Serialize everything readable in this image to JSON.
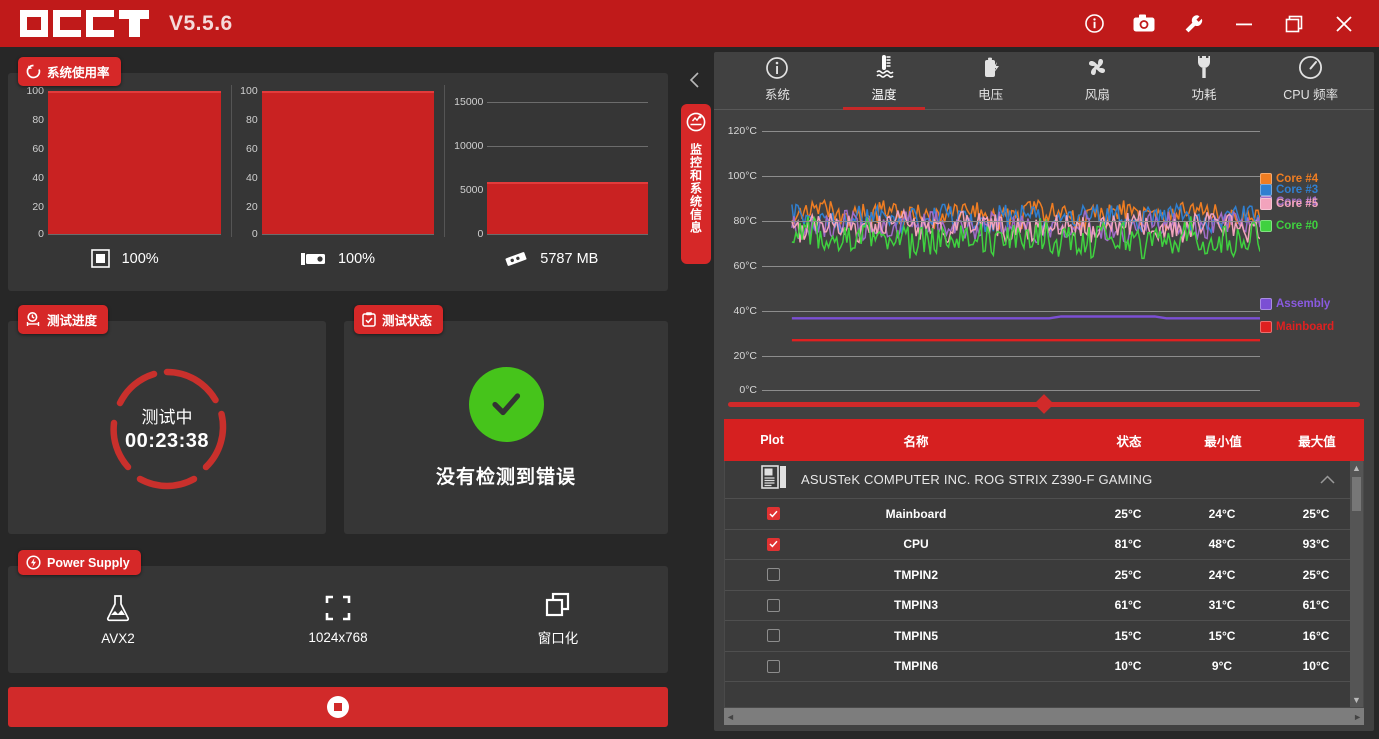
{
  "titlebar": {
    "app_name": "OCCT",
    "version": "V5.5.6",
    "brand_color": "#c01a1a",
    "actions": [
      {
        "name": "info-icon",
        "label": "Info"
      },
      {
        "name": "camera-icon",
        "label": "Screenshot"
      },
      {
        "name": "wrench-icon",
        "label": "Settings"
      },
      {
        "name": "minimize-icon",
        "label": "Minimize"
      },
      {
        "name": "restore-icon",
        "label": "Restore"
      },
      {
        "name": "close-icon",
        "label": "Close"
      }
    ]
  },
  "left": {
    "usage": {
      "badge": "系统使用率",
      "gauges": [
        {
          "label": "100%",
          "icon": "cpu-icon",
          "ticks": [
            "100",
            "80",
            "60",
            "40",
            "20",
            "0"
          ],
          "max": 100,
          "value": 100
        },
        {
          "label": "100%",
          "icon": "gpu-icon",
          "ticks": [
            "100",
            "80",
            "60",
            "40",
            "20",
            "0"
          ],
          "max": 100,
          "value": 100
        },
        {
          "label": "5787 MB",
          "icon": "ram-icon",
          "ticks": [
            "15000",
            "10000",
            "5000",
            "0"
          ],
          "max": 16384,
          "value": 5787
        }
      ]
    },
    "progress": {
      "badge": "测试进度",
      "state_label": "测试中",
      "elapsed": "00:23:38"
    },
    "status": {
      "badge": "测试状态",
      "message": "没有检测到错误",
      "ok_color": "#46c41b"
    },
    "power_supply": {
      "badge": "Power Supply",
      "items": [
        {
          "icon": "flask-icon",
          "label": "AVX2"
        },
        {
          "icon": "resolution-icon",
          "label": "1024x768"
        },
        {
          "icon": "window-icon",
          "label": "窗口化"
        }
      ]
    },
    "stop_button": {
      "label": "",
      "icon": "stop-icon"
    }
  },
  "sidebar": {
    "collapse_icon": "chevron-left-icon",
    "vertical_tab": {
      "label": "监控和系统信息",
      "icon": "monitor-icon"
    }
  },
  "right": {
    "tabs": [
      {
        "label": "系统",
        "icon": "info-circle-icon",
        "active": false
      },
      {
        "label": "温度",
        "icon": "thermometer-icon",
        "active": true
      },
      {
        "label": "电压",
        "icon": "battery-bolt-icon",
        "active": false
      },
      {
        "label": "风扇",
        "icon": "fan-icon",
        "active": false
      },
      {
        "label": "功耗",
        "icon": "plug-icon",
        "active": false
      },
      {
        "label": "CPU 频率",
        "icon": "speedometer-icon",
        "active": false
      }
    ],
    "table": {
      "columns": [
        "Plot",
        "名称",
        "状态",
        "最小值",
        "最大值"
      ],
      "group": {
        "icon": "motherboard-icon",
        "name": "ASUSTeK COMPUTER INC. ROG STRIX Z390-F GAMING",
        "collapse_icon": "chevron-up-icon"
      },
      "rows": [
        {
          "checked": true,
          "name": "Mainboard",
          "current": "25°C",
          "min": "24°C",
          "max": "25°C"
        },
        {
          "checked": true,
          "name": "CPU",
          "current": "81°C",
          "min": "48°C",
          "max": "93°C"
        },
        {
          "checked": false,
          "name": "TMPIN2",
          "current": "25°C",
          "min": "24°C",
          "max": "25°C"
        },
        {
          "checked": false,
          "name": "TMPIN3",
          "current": "61°C",
          "min": "31°C",
          "max": "61°C"
        },
        {
          "checked": false,
          "name": "TMPIN5",
          "current": "15°C",
          "min": "15°C",
          "max": "16°C"
        },
        {
          "checked": false,
          "name": "TMPIN6",
          "current": "10°C",
          "min": "9°C",
          "max": "10°C"
        }
      ]
    }
  },
  "chart_data": {
    "type": "line",
    "title": "温度",
    "xlabel": "",
    "ylabel": "°C",
    "ylim": [
      0,
      130
    ],
    "yticks": [
      0,
      20,
      40,
      60,
      80,
      100,
      120
    ],
    "ytick_labels": [
      "0°C",
      "20°C",
      "40°C",
      "60°C",
      "80°C",
      "100°C",
      "120°C"
    ],
    "grid": true,
    "legend_position": "right",
    "series": [
      {
        "name": "Core #4",
        "color": "#ef7d22",
        "mean": 88,
        "min": 80,
        "max": 95
      },
      {
        "name": "Core #3",
        "color": "#2f7fd0",
        "mean": 86,
        "min": 78,
        "max": 93
      },
      {
        "name": "Core #1",
        "color": "#a06cc8",
        "mean": 82,
        "min": 74,
        "max": 90
      },
      {
        "name": "Core #5",
        "color": "#f2a3bc",
        "mean": 82,
        "min": 74,
        "max": 90
      },
      {
        "name": "Core #0",
        "color": "#3fd13f",
        "mean": 76,
        "min": 66,
        "max": 88
      },
      {
        "name": "Assembly",
        "color": "#7b4fd4",
        "mean": 36,
        "min": 35,
        "max": 37
      },
      {
        "name": "Mainboard",
        "color": "#e02020",
        "mean": 25,
        "min": 24,
        "max": 25
      }
    ]
  }
}
